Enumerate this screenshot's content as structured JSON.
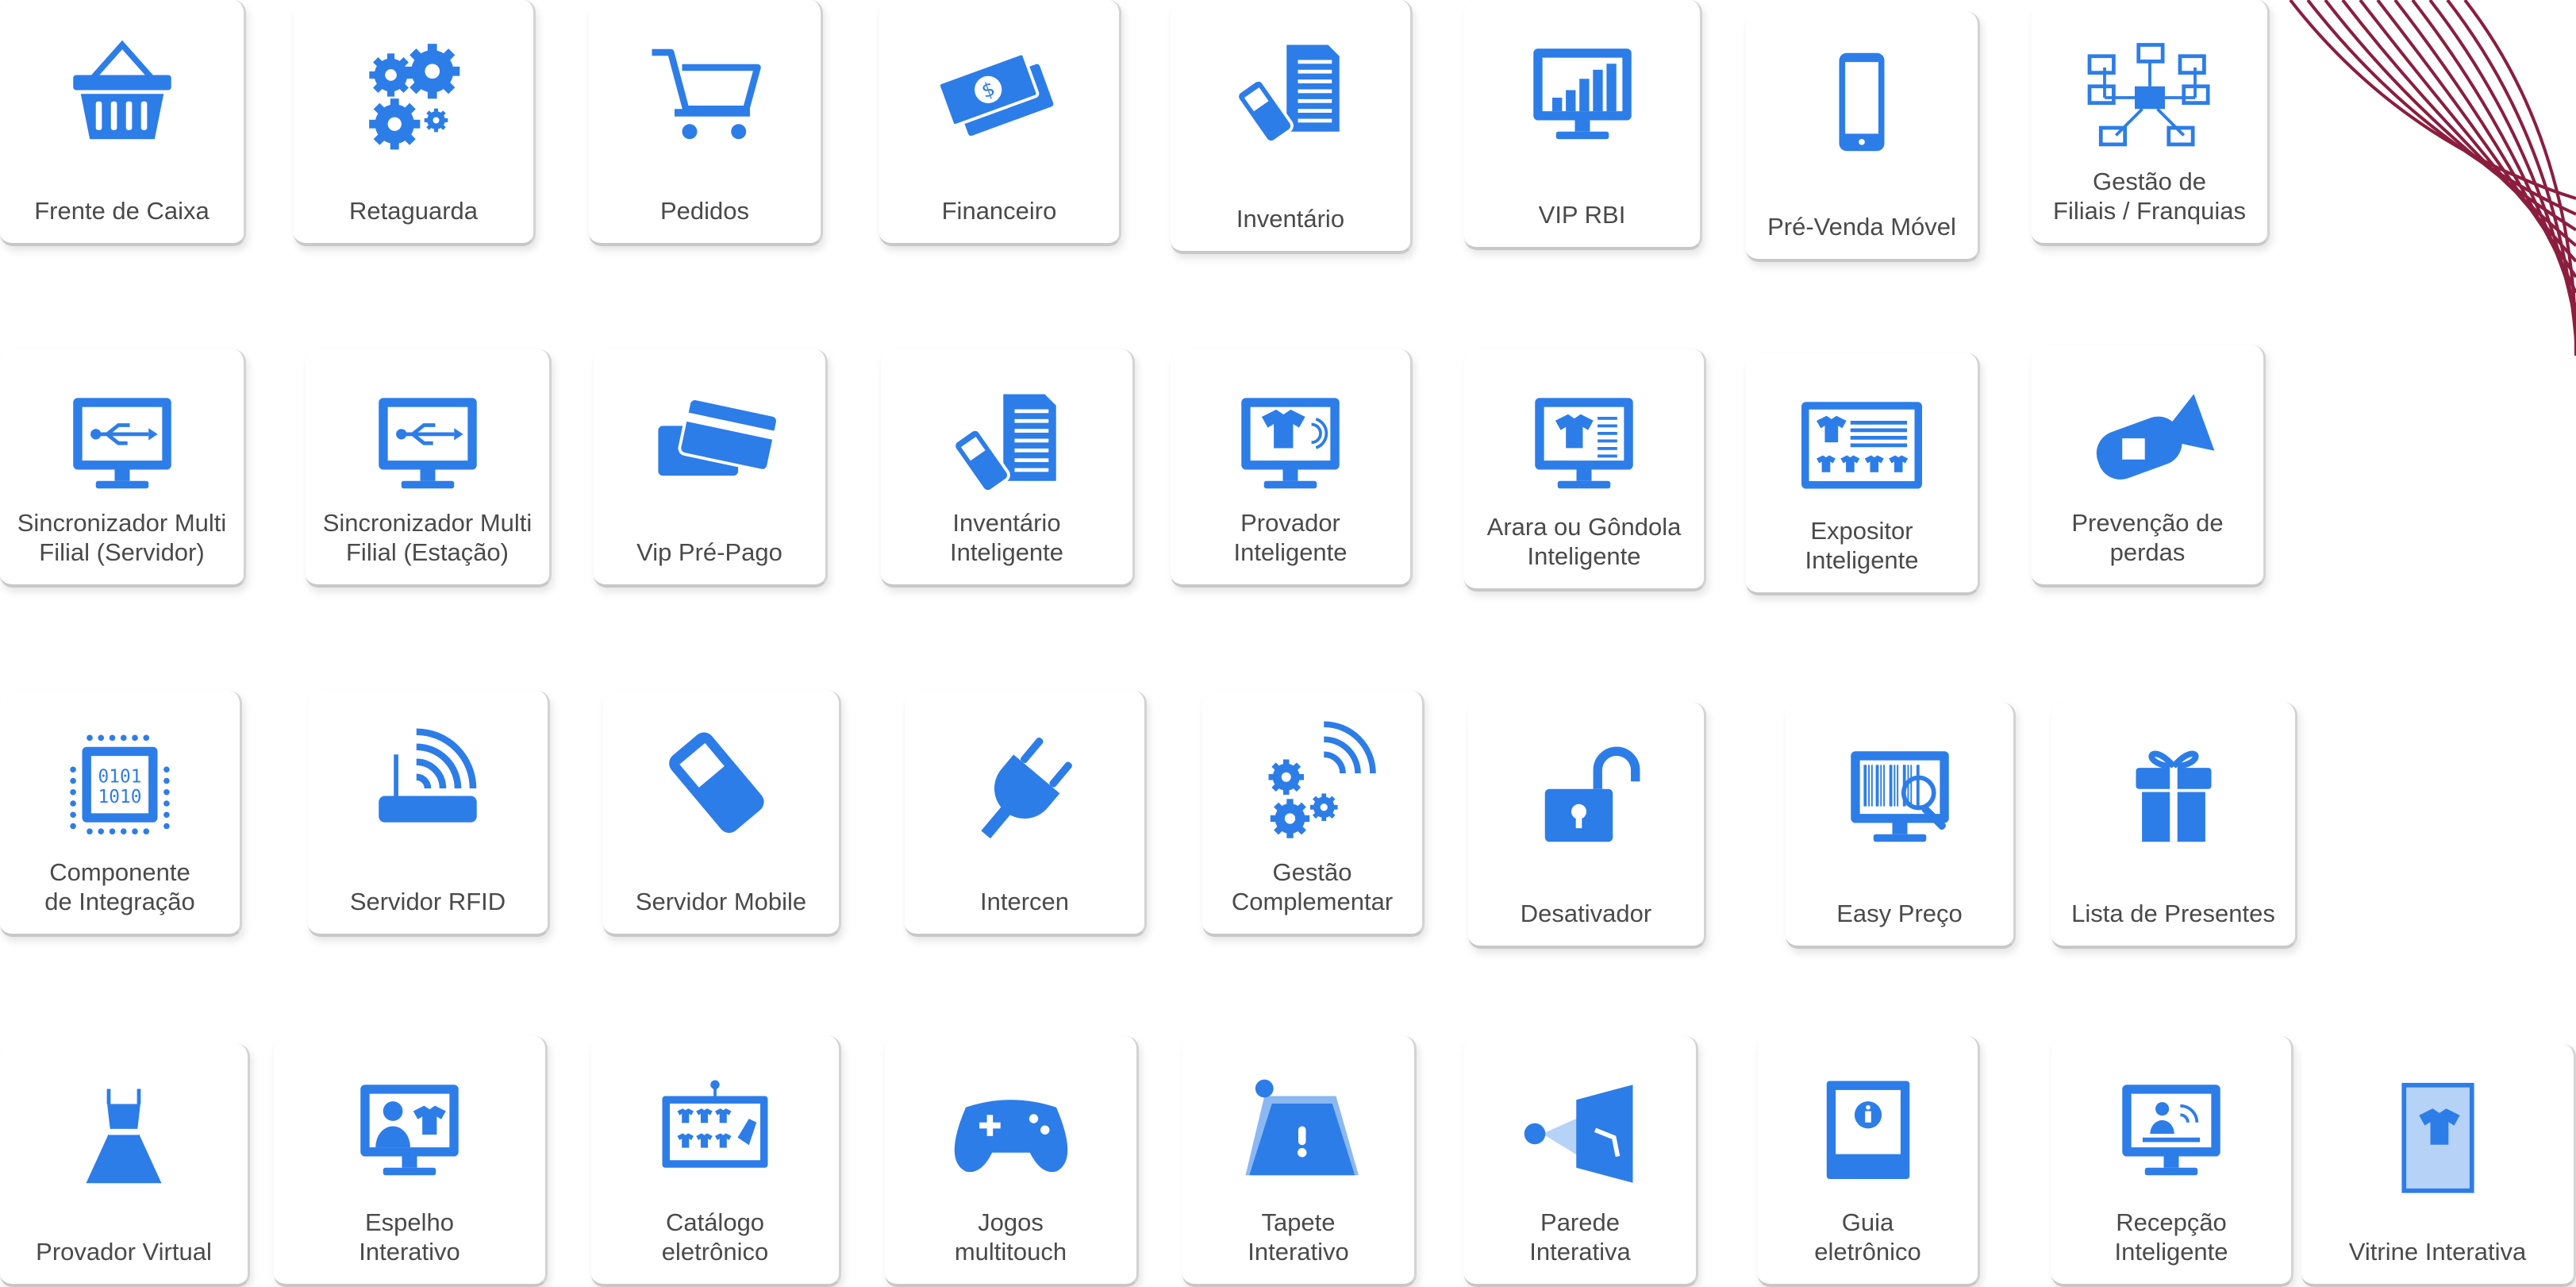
{
  "brand": {
    "accent": "#2d7de8",
    "label_color": "#4a4a4a",
    "deco_color": "#8b1e3f"
  },
  "modules": [
    {
      "label": "Frente de Caixa",
      "icon": "shopping-basket-icon"
    },
    {
      "label": "Retaguarda",
      "icon": "gears-icon"
    },
    {
      "label": "Pedidos",
      "icon": "shopping-cart-icon"
    },
    {
      "label": "Financeiro",
      "icon": "banknotes-icon"
    },
    {
      "label": "Inventário",
      "icon": "scanner-document-icon"
    },
    {
      "label": "VIP RBI",
      "icon": "bar-chart-monitor-icon"
    },
    {
      "label": "Pré-Venda Móvel",
      "icon": "smartphone-icon"
    },
    {
      "label": "Gestão de\nFiliais / Franquias",
      "icon": "network-icon"
    },
    {
      "label": "Sincronizador Multi\nFilial (Servidor)",
      "icon": "usb-monitor-icon"
    },
    {
      "label": "Sincronizador Multi\nFilial (Estação)",
      "icon": "usb-monitor-icon"
    },
    {
      "label": "Vip Pré-Pago",
      "icon": "credit-cards-icon"
    },
    {
      "label": "Inventário\nInteligente",
      "icon": "scanner-document-icon"
    },
    {
      "label": "Provador\nInteligente",
      "icon": "shirt-monitor-icon"
    },
    {
      "label": "Arara ou Gôndola\nInteligente",
      "icon": "hanger-monitor-icon"
    },
    {
      "label": "Expositor\nInteligente",
      "icon": "shirts-display-icon"
    },
    {
      "label": "Prevenção de\nperdas",
      "icon": "security-camera-icon"
    },
    {
      "label": "Componente\nde Integração",
      "icon": "chip-icon"
    },
    {
      "label": "Servidor RFID",
      "icon": "rfid-router-icon"
    },
    {
      "label": "Servidor Mobile",
      "icon": "handheld-scanner-icon"
    },
    {
      "label": "Intercen",
      "icon": "plug-icon"
    },
    {
      "label": "Gestão\nComplementar",
      "icon": "gears-wireless-icon"
    },
    {
      "label": "Desativador",
      "icon": "unlocked-padlock-icon"
    },
    {
      "label": "Easy Preço",
      "icon": "barcode-search-icon"
    },
    {
      "label": "Lista de Presentes",
      "icon": "gift-icon"
    },
    {
      "label": "Provador Virtual",
      "icon": "dress-icon"
    },
    {
      "label": "Espelho\nInterativo",
      "icon": "mirror-monitor-icon"
    },
    {
      "label": "Catálogo\neletrônico",
      "icon": "touch-catalog-icon"
    },
    {
      "label": "Jogos\nmultitouch",
      "icon": "gamepad-icon"
    },
    {
      "label": "Tapete\nInterativo",
      "icon": "interactive-floor-icon"
    },
    {
      "label": "Parede\nInterativa",
      "icon": "projector-wall-icon"
    },
    {
      "label": "Guia\neletrônico",
      "icon": "info-kiosk-icon"
    },
    {
      "label": "Recepção\nInteligente",
      "icon": "reception-monitor-icon"
    },
    {
      "label": "Vitrine Interativa",
      "icon": "shop-window-icon"
    }
  ]
}
